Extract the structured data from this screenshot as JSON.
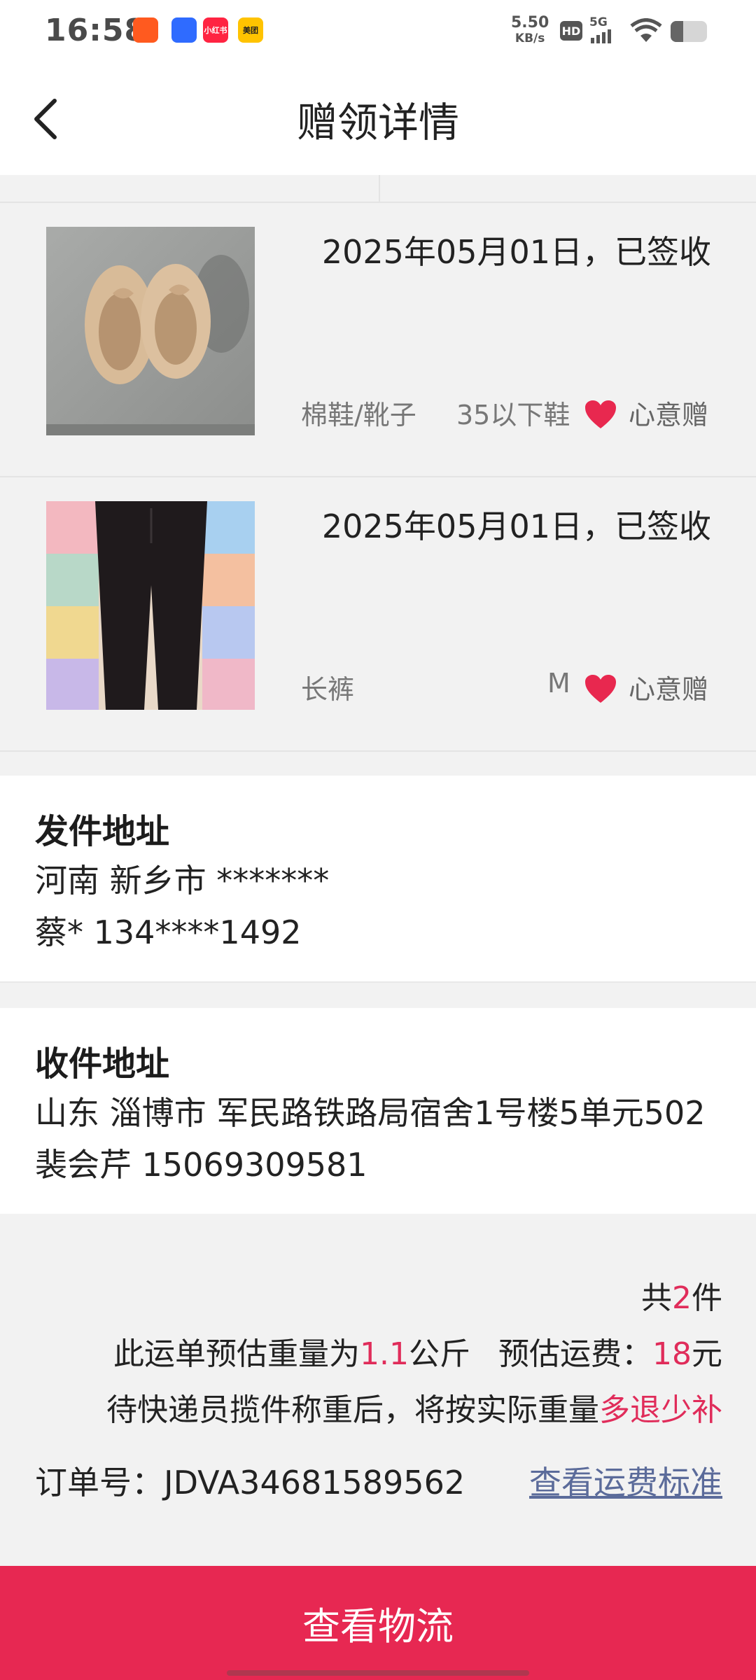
{
  "status_bar": {
    "time": "16:58",
    "net_speed_value": "5.50",
    "net_speed_unit": "KB/s",
    "hd": "HD",
    "network": "5G",
    "battery_level": 0.35,
    "app_icons": [
      {
        "name": "kuaishou-app-icon",
        "color": "#ff5a1f",
        "label": ""
      },
      {
        "name": "baidu-app-icon",
        "color": "#2f6bff",
        "label": ""
      },
      {
        "name": "xiaohongshu-app-icon",
        "color": "#ff2442",
        "label": "小红书"
      },
      {
        "name": "meituan-app-icon",
        "color": "#ffc300",
        "label": "美团"
      }
    ]
  },
  "header": {
    "title": "赠领详情",
    "back_icon": "chevron-left-icon"
  },
  "items": [
    {
      "date_status": "2025年05月01日，已签收",
      "category": "棉鞋/靴子",
      "size": "35以下鞋",
      "gift_type": "心意赠",
      "heart_color": "#e8284f"
    },
    {
      "date_status": "2025年05月01日，已签收",
      "category": "长裤",
      "size": "M",
      "gift_type": "心意赠",
      "heart_color": "#e8284f"
    }
  ],
  "sender": {
    "title": "发件地址",
    "address": "河南 新乡市 *******",
    "contact": "蔡* 134****1492"
  },
  "receiver": {
    "title": "收件地址",
    "address": "山东 淄博市 军民路铁路局宿舍1号楼5单元502",
    "contact": "裴会芹 15069309581"
  },
  "summary": {
    "count_prefix": "共",
    "count": "2",
    "count_suffix": "件",
    "weight_prefix": "此运单预估重量为",
    "weight": "1.1",
    "weight_unit": "公斤",
    "fee_label": "预估运费：",
    "fee": "18",
    "fee_unit": "元",
    "note_prefix": "待快递员揽件称重后，将按实际重量",
    "note_highlight": "多退少补",
    "order_label": "订单号：",
    "order_number": "JDVA34681589562",
    "fee_standard_link": "查看运费标准"
  },
  "bottom_button": {
    "label": "查看物流"
  },
  "colors": {
    "accent": "#e72852",
    "highlight": "#e02c5a",
    "link": "#5b6b9a"
  }
}
